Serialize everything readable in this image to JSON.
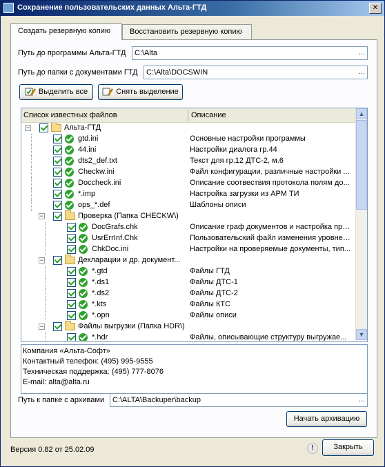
{
  "window": {
    "title": "Сохранение пользовательских данных Альта-ГТД"
  },
  "tabs": [
    {
      "label": "Создать резервную копию",
      "active": true
    },
    {
      "label": "Восстановить резервную копию",
      "active": false
    }
  ],
  "program_path": {
    "label": "Путь до программы Альта-ГТД",
    "value": "C:\\Alta",
    "browse": "..."
  },
  "docs_path": {
    "label": "Путь до папки с документами ГТД",
    "value": "C:\\Alta\\DOCSWIN",
    "browse": "..."
  },
  "buttons": {
    "select_all": "Выделить все",
    "deselect": "Снять выделение",
    "start_archive": "Начать архивацию",
    "close": "Закрыть"
  },
  "tree": {
    "col_files": "Список известных файлов",
    "col_desc": "Описание",
    "rows": [
      {
        "level": 0,
        "type": "folder",
        "name": "Альта-ГТД",
        "desc": ""
      },
      {
        "level": 1,
        "type": "file",
        "name": "gtd.ini",
        "desc": "Основные настройки программы"
      },
      {
        "level": 1,
        "type": "file",
        "name": "44.ini",
        "desc": "Настройки диалога гр.44"
      },
      {
        "level": 1,
        "type": "file",
        "name": "dts2_def.txt",
        "desc": "Текст для гр.12 ДТС-2, м.6"
      },
      {
        "level": 1,
        "type": "file",
        "name": "Checkw.ini",
        "desc": "Файл конфигурации, различные настройки ..."
      },
      {
        "level": 1,
        "type": "file",
        "name": "Doccheck.ini",
        "desc": "Описание соотвествия протокола полям до..."
      },
      {
        "level": 1,
        "type": "file",
        "name": "*.imp",
        "desc": "Настройка загрузки из АРМ ТИ"
      },
      {
        "level": 1,
        "type": "file",
        "name": "ops_*.def",
        "desc": "Шаблоны описи"
      },
      {
        "level": 1,
        "type": "folder",
        "name": "Проверка (Папка CHECKW\\)",
        "desc": ""
      },
      {
        "level": 2,
        "type": "file",
        "name": "DocGrafs.chk",
        "desc": "Описание граф документов и настройка про..."
      },
      {
        "level": 2,
        "type": "file",
        "name": "UsrErrInf.Chk",
        "desc": "Пользовательский файл изменения уровней..."
      },
      {
        "level": 2,
        "type": "file",
        "name": "ChkDoc.ini",
        "desc": "Настройки на проверяемые документы, тип..."
      },
      {
        "level": 1,
        "type": "folder",
        "name": "Декларации и др. документ...",
        "desc": ""
      },
      {
        "level": 2,
        "type": "file",
        "name": "*.gtd",
        "desc": "Файлы ГТД"
      },
      {
        "level": 2,
        "type": "file",
        "name": "*.ds1",
        "desc": "Файлы ДТС-1"
      },
      {
        "level": 2,
        "type": "file",
        "name": "*.ds2",
        "desc": "Файлы ДТС-2"
      },
      {
        "level": 2,
        "type": "file",
        "name": "*.kts",
        "desc": "Файлы КТС"
      },
      {
        "level": 2,
        "type": "file",
        "name": "*.opn",
        "desc": "Файлы описи"
      },
      {
        "level": 1,
        "type": "folder",
        "name": "Файлы выгрузки (Папка HDR\\)",
        "desc": ""
      },
      {
        "level": 2,
        "type": "file",
        "name": "*.hdr",
        "desc": "Файлы, описывающие структуру выгружае..."
      }
    ]
  },
  "info": {
    "company": "Компания «Альта-Софт»",
    "phone": "Контактный телефон: (495) 995-9555",
    "support": "Техническая поддержка: (495) 777-8076",
    "email": "E-mail: alta@alta.ru"
  },
  "archive_path": {
    "label": "Путь к папке с архивами",
    "value": "C:\\ALTA\\Backuper\\backup",
    "browse": "..."
  },
  "footer": {
    "version": "Версия 0.82 от 25.02.09"
  }
}
